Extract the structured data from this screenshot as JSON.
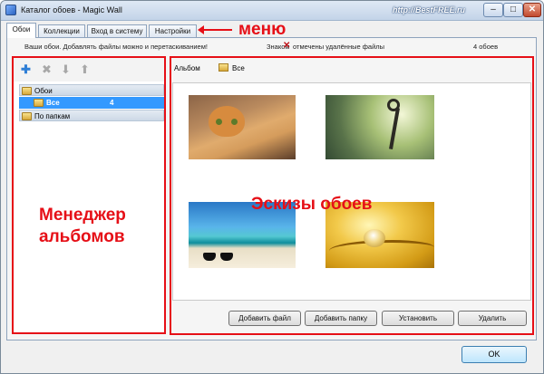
{
  "window": {
    "title": "Каталог обоев - Magic Wall",
    "watermark": "http://BestFREE.ru",
    "min_glyph": "–",
    "max_glyph": "□",
    "close_glyph": "✕"
  },
  "tabs": [
    {
      "label": "Обои",
      "active": true
    },
    {
      "label": "Коллекции",
      "active": false
    },
    {
      "label": "Вход в систему",
      "active": false
    },
    {
      "label": "Настройки",
      "active": false
    }
  ],
  "info_bar": {
    "hint": "Ваши обои. Добавлять файлы можно и перетаскиванием!",
    "znakom": "Знаком",
    "deleted_note": "отмечены удалённые файлы",
    "count": "4 обоев"
  },
  "annotations": {
    "menu": "меню",
    "manager_line1": "Менеджер",
    "manager_line2": "альбомов",
    "thumbs": "Эскизы обоев",
    "color": "#e60f17"
  },
  "left_toolbar": {
    "icons": [
      "add-icon",
      "delete-icon",
      "move-down-icon",
      "move-up-icon"
    ]
  },
  "tree": {
    "group1": "Обои",
    "selected_item": "Все",
    "selected_count": "4",
    "group2": "По папкам"
  },
  "album_bar": {
    "label": "Альбом",
    "value": "Все"
  },
  "thumbnails": [
    {
      "name": "cat-wallpaper"
    },
    {
      "name": "key-wallpaper"
    },
    {
      "name": "sea-wallpaper"
    },
    {
      "name": "drop-wallpaper"
    }
  ],
  "buttons": {
    "add_file": "Добавить файл",
    "add_folder": "Добавить папку",
    "install": "Установить",
    "delete": "Удалить",
    "ok": "OK"
  }
}
